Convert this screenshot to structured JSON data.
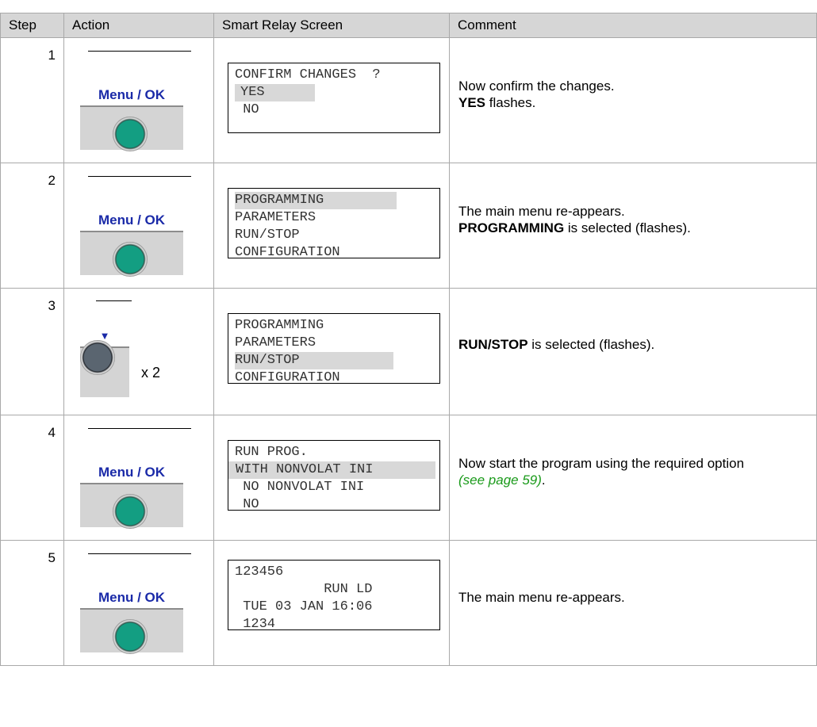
{
  "table": {
    "headers": [
      "Step",
      "Action",
      "Smart Relay Screen",
      "Comment"
    ],
    "rows": [
      {
        "step": "1",
        "key_label": "Menu / OK",
        "screen": {
          "l1": "CONFIRM CHANGES  ?",
          "l2": "YES",
          "l3": " NO",
          "l4": ""
        },
        "comment": {
          "line1": "Now confirm the changes.",
          "bold": "YES",
          "rest": " flashes."
        }
      },
      {
        "step": "2",
        "key_label": "Menu / OK",
        "screen": {
          "l1": "PROGRAMMING",
          "l2": "PARAMETERS",
          "l3": "RUN/STOP",
          "l4": "CONFIGURATION"
        },
        "comment": {
          "line1": "The main menu re-appears.",
          "bold": "PROGRAMMING",
          "rest": " is selected (flashes)."
        }
      },
      {
        "step": "3",
        "key_label": "▼",
        "multiplier": "x 2",
        "screen": {
          "l1": "PROGRAMMING",
          "l2": "PARAMETERS",
          "l3": "RUN/STOP",
          "l4": "CONFIGURATION"
        },
        "comment": {
          "bold": "RUN/STOP",
          "rest": " is selected (flashes)."
        }
      },
      {
        "step": "4",
        "key_label": "Menu / OK",
        "screen": {
          "l1": "RUN PROG.",
          "l2": "WITH NONVOLAT INI",
          "l3": " NO NONVOLAT INI",
          "l4": " NO"
        },
        "comment": {
          "line1": "Now start the program using the required option",
          "link": "(see page 59)",
          "tail": "."
        }
      },
      {
        "step": "5",
        "key_label": "Menu / OK",
        "screen": {
          "l1": "123456",
          "l2": "           RUN LD",
          "l3": " TUE 03 JAN 16:06",
          "l4": " 1234"
        },
        "comment": {
          "line1": "The main menu re-appears."
        }
      }
    ]
  },
  "colors": {
    "header_bg": "#d6d6d6",
    "key_label": "#1a2aa8",
    "ok_button": "#139e82",
    "arrow_button": "#5a6570",
    "link": "#1a9a1a"
  },
  "icons": {
    "menu_ok_button": "green-round-button",
    "down_button": "grey-round-button"
  }
}
